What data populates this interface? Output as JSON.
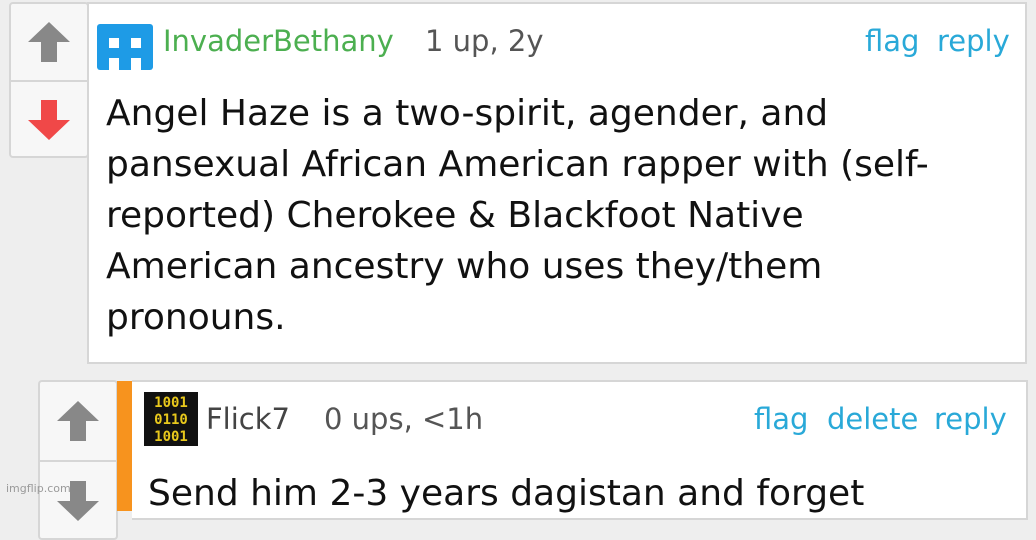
{
  "comments": [
    {
      "username": "InvaderBethany",
      "meta": "1 up, 2y",
      "actions": [
        "flag",
        "reply"
      ],
      "body": "Angel Haze is a two-spirit, agender, and\npansexual African American rapper with (self-\nreported) Cherokee & Blackfoot Native\nAmerican ancestry who uses they/them\npronouns.",
      "username_color": "#4caf50",
      "avatar": "space-invader-avatar",
      "avatar_color": "#1e9be6"
    },
    {
      "username": "Flick7",
      "meta": "0 ups, <1h",
      "actions": [
        "flag",
        "delete",
        "reply"
      ],
      "body": "Send him 2-3 years dagistan and forget",
      "username_color": "#444444",
      "avatar": "binary-code-avatar",
      "avatar_color": "#e8c81c",
      "accent_color": "#f7931e"
    }
  ],
  "watermark": "imgflip.com",
  "colors": {
    "action": "#29a9d8",
    "upvote": "#888888",
    "downvote": "#f04848"
  },
  "icons": [
    "arrow-up-icon",
    "arrow-down-icon"
  ]
}
